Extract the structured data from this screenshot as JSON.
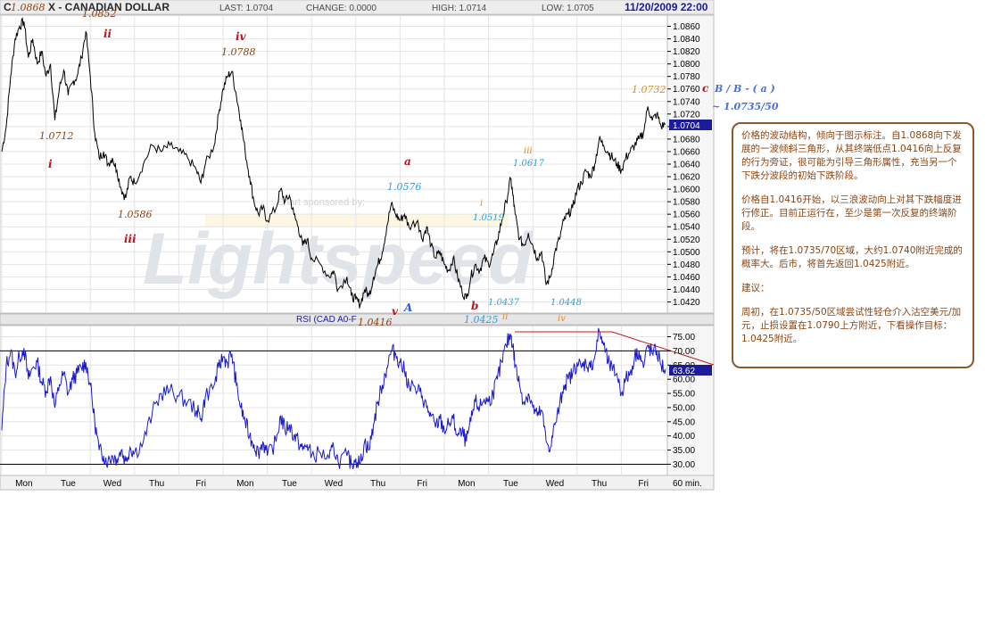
{
  "header": {
    "symbol": "C",
    "title": "X - CANADIAN DOLLAR",
    "last": "LAST: 1.0704",
    "change": "CHANGE: 0.0000",
    "high": "HIGH: 1.0714",
    "low": "LOW: 1.0705",
    "datetime": "11/20/2009 22:00"
  },
  "chart_data": [
    {
      "type": "line",
      "name": "price",
      "ylim": [
        1.0405,
        1.0875
      ],
      "yticks": [
        "1.0860",
        "1.0840",
        "1.0820",
        "1.0800",
        "1.0780",
        "1.0760",
        "1.0740",
        "1.0720",
        "1.0700",
        "1.0680",
        "1.0660",
        "1.0640",
        "1.0620",
        "1.0600",
        "1.0580",
        "1.0560",
        "1.0540",
        "1.0520",
        "1.0500",
        "1.0480",
        "1.0460",
        "1.0440",
        "1.0420"
      ],
      "last_value_label": "1.0704",
      "last_value": 1.0704,
      "x_days": [
        "Mon",
        "Tue",
        "Wed",
        "Thu",
        "Fri",
        "Mon",
        "Tue",
        "Wed",
        "Thu",
        "Fri",
        "Mon",
        "Tue",
        "Wed",
        "Thu",
        "Fri"
      ],
      "x_interval_label": "60 min.",
      "x_range": [
        0,
        15
      ],
      "path": [
        [
          0.0,
          1.066
        ],
        [
          0.1,
          1.07
        ],
        [
          0.2,
          1.078
        ],
        [
          0.3,
          1.084
        ],
        [
          0.4,
          1.086
        ],
        [
          0.5,
          1.0868
        ],
        [
          0.6,
          1.081
        ],
        [
          0.7,
          1.084
        ],
        [
          0.8,
          1.08
        ],
        [
          0.9,
          1.082
        ],
        [
          1.0,
          1.078
        ],
        [
          1.1,
          1.08
        ],
        [
          1.2,
          1.071
        ],
        [
          1.3,
          1.076
        ],
        [
          1.4,
          1.079
        ],
        [
          1.5,
          1.075
        ],
        [
          1.6,
          1.077
        ],
        [
          1.7,
          1.078
        ],
        [
          1.8,
          1.081
        ],
        [
          1.9,
          1.0852
        ],
        [
          2.0,
          1.078
        ],
        [
          2.1,
          1.069
        ],
        [
          2.2,
          1.065
        ],
        [
          2.3,
          1.066
        ],
        [
          2.4,
          1.064
        ],
        [
          2.5,
          1.065
        ],
        [
          2.6,
          1.063
        ],
        [
          2.7,
          1.06
        ],
        [
          2.8,
          1.0586
        ],
        [
          2.9,
          1.062
        ],
        [
          3.0,
          1.061
        ],
        [
          3.2,
          1.064
        ],
        [
          3.4,
          1.067
        ],
        [
          3.6,
          1.066
        ],
        [
          3.8,
          1.067
        ],
        [
          4.0,
          1.066
        ],
        [
          4.2,
          1.065
        ],
        [
          4.4,
          1.063
        ],
        [
          4.5,
          1.061
        ],
        [
          4.6,
          1.064
        ],
        [
          4.8,
          1.067
        ],
        [
          4.9,
          1.072
        ],
        [
          5.0,
          1.076
        ],
        [
          5.1,
          1.078
        ],
        [
          5.2,
          1.0788
        ],
        [
          5.3,
          1.075
        ],
        [
          5.4,
          1.071
        ],
        [
          5.5,
          1.066
        ],
        [
          5.6,
          1.062
        ],
        [
          5.7,
          1.058
        ],
        [
          5.8,
          1.056
        ],
        [
          5.9,
          1.057
        ],
        [
          6.0,
          1.055
        ],
        [
          6.2,
          1.057
        ],
        [
          6.3,
          1.06
        ],
        [
          6.4,
          1.058
        ],
        [
          6.5,
          1.059
        ],
        [
          6.6,
          1.056
        ],
        [
          6.7,
          1.054
        ],
        [
          6.8,
          1.051
        ],
        [
          6.9,
          1.052
        ],
        [
          7.0,
          1.049
        ],
        [
          7.2,
          1.048
        ],
        [
          7.4,
          1.046
        ],
        [
          7.5,
          1.047
        ],
        [
          7.6,
          1.044
        ],
        [
          7.8,
          1.046
        ],
        [
          7.9,
          1.043
        ],
        [
          8.0,
          1.0424
        ],
        [
          8.1,
          1.0416
        ],
        [
          8.2,
          1.044
        ],
        [
          8.3,
          1.043
        ],
        [
          8.4,
          1.046
        ],
        [
          8.5,
          1.048
        ],
        [
          8.6,
          1.05
        ],
        [
          8.7,
          1.054
        ],
        [
          8.8,
          1.0576
        ],
        [
          8.9,
          1.056
        ],
        [
          9.0,
          1.055
        ],
        [
          9.1,
          1.056
        ],
        [
          9.2,
          1.054
        ],
        [
          9.4,
          1.055
        ],
        [
          9.5,
          1.052
        ],
        [
          9.6,
          1.054
        ],
        [
          9.7,
          1.051
        ],
        [
          9.8,
          1.049
        ],
        [
          9.9,
          1.05
        ],
        [
          10.0,
          1.048
        ],
        [
          10.1,
          1.047
        ],
        [
          10.2,
          1.049
        ],
        [
          10.3,
          1.046
        ],
        [
          10.4,
          1.0437
        ],
        [
          10.5,
          1.0425
        ],
        [
          10.6,
          1.046
        ],
        [
          10.7,
          1.048
        ],
        [
          10.8,
          1.047
        ],
        [
          10.9,
          1.049
        ],
        [
          11.0,
          1.048
        ],
        [
          11.1,
          1.0495
        ],
        [
          11.2,
          1.0519
        ],
        [
          11.3,
          1.055
        ],
        [
          11.4,
          1.058
        ],
        [
          11.5,
          1.0617
        ],
        [
          11.55,
          1.059
        ],
        [
          11.6,
          1.056
        ],
        [
          11.7,
          1.052
        ],
        [
          11.8,
          1.051
        ],
        [
          11.9,
          1.053
        ],
        [
          12.0,
          1.051
        ],
        [
          12.1,
          1.049
        ],
        [
          12.2,
          1.05
        ],
        [
          12.3,
          1.0448
        ],
        [
          12.4,
          1.046
        ],
        [
          12.5,
          1.05
        ],
        [
          12.6,
          1.052
        ],
        [
          12.7,
          1.055
        ],
        [
          12.8,
          1.056
        ],
        [
          12.9,
          1.057
        ],
        [
          13.0,
          1.06
        ],
        [
          13.1,
          1.061
        ],
        [
          13.2,
          1.063
        ],
        [
          13.3,
          1.062
        ],
        [
          13.4,
          1.064
        ],
        [
          13.5,
          1.068
        ],
        [
          13.6,
          1.067
        ],
        [
          13.7,
          1.066
        ],
        [
          13.8,
          1.065
        ],
        [
          13.9,
          1.064
        ],
        [
          14.0,
          1.063
        ],
        [
          14.1,
          1.065
        ],
        [
          14.2,
          1.066
        ],
        [
          14.3,
          1.067
        ],
        [
          14.4,
          1.068
        ],
        [
          14.5,
          1.069
        ],
        [
          14.6,
          1.0732
        ],
        [
          14.7,
          1.071
        ],
        [
          14.8,
          1.072
        ],
        [
          14.9,
          1.07
        ],
        [
          15.0,
          1.0704
        ]
      ]
    },
    {
      "type": "line",
      "name": "rsi",
      "title": "RSI (CAD A0-F",
      "ylim": [
        27,
        78
      ],
      "yticks": [
        "75.00",
        "70.00",
        "65.00",
        "60.00",
        "55.00",
        "50.00",
        "45.00",
        "40.00",
        "35.00",
        "30.00"
      ],
      "last_value_label": "63.62",
      "last_value": 63.62,
      "levels": [
        70,
        30
      ],
      "path": [
        [
          0.0,
          42
        ],
        [
          0.1,
          65
        ],
        [
          0.2,
          70
        ],
        [
          0.3,
          62
        ],
        [
          0.4,
          68
        ],
        [
          0.5,
          71
        ],
        [
          0.6,
          60
        ],
        [
          0.7,
          64
        ],
        [
          0.8,
          66
        ],
        [
          0.9,
          59
        ],
        [
          1.0,
          56
        ],
        [
          1.1,
          61
        ],
        [
          1.2,
          50
        ],
        [
          1.3,
          58
        ],
        [
          1.4,
          62
        ],
        [
          1.5,
          55
        ],
        [
          1.6,
          60
        ],
        [
          1.7,
          62
        ],
        [
          1.8,
          64
        ],
        [
          1.9,
          66
        ],
        [
          2.0,
          58
        ],
        [
          2.1,
          45
        ],
        [
          2.2,
          35
        ],
        [
          2.3,
          33
        ],
        [
          2.4,
          31
        ],
        [
          2.5,
          33
        ],
        [
          2.6,
          32
        ],
        [
          2.7,
          35
        ],
        [
          2.8,
          31
        ],
        [
          2.9,
          36
        ],
        [
          3.0,
          34
        ],
        [
          3.2,
          38
        ],
        [
          3.4,
          48
        ],
        [
          3.6,
          55
        ],
        [
          3.8,
          56
        ],
        [
          4.0,
          54
        ],
        [
          4.2,
          52
        ],
        [
          4.4,
          49
        ],
        [
          4.5,
          46
        ],
        [
          4.6,
          54
        ],
        [
          4.8,
          58
        ],
        [
          4.9,
          64
        ],
        [
          5.0,
          68
        ],
        [
          5.1,
          66
        ],
        [
          5.2,
          69
        ],
        [
          5.3,
          58
        ],
        [
          5.4,
          50
        ],
        [
          5.5,
          45
        ],
        [
          5.6,
          40
        ],
        [
          5.7,
          37
        ],
        [
          5.8,
          34
        ],
        [
          5.9,
          38
        ],
        [
          6.0,
          33
        ],
        [
          6.2,
          38
        ],
        [
          6.3,
          47
        ],
        [
          6.4,
          42
        ],
        [
          6.5,
          44
        ],
        [
          6.6,
          40
        ],
        [
          6.7,
          38
        ],
        [
          6.8,
          35
        ],
        [
          6.9,
          37
        ],
        [
          7.0,
          33
        ],
        [
          7.2,
          34
        ],
        [
          7.4,
          32
        ],
        [
          7.5,
          36
        ],
        [
          7.6,
          31
        ],
        [
          7.8,
          33
        ],
        [
          7.9,
          30
        ],
        [
          8.0,
          32
        ],
        [
          8.1,
          30
        ],
        [
          8.2,
          38
        ],
        [
          8.3,
          35
        ],
        [
          8.4,
          44
        ],
        [
          8.5,
          52
        ],
        [
          8.6,
          58
        ],
        [
          8.7,
          64
        ],
        [
          8.8,
          70
        ],
        [
          8.9,
          69
        ],
        [
          9.0,
          66
        ],
        [
          9.1,
          63
        ],
        [
          9.2,
          58
        ],
        [
          9.4,
          56
        ],
        [
          9.5,
          54
        ],
        [
          9.6,
          50
        ],
        [
          9.7,
          47
        ],
        [
          9.8,
          43
        ],
        [
          9.9,
          46
        ],
        [
          10.0,
          42
        ],
        [
          10.1,
          44
        ],
        [
          10.2,
          46
        ],
        [
          10.3,
          40
        ],
        [
          10.4,
          41
        ],
        [
          10.5,
          38
        ],
        [
          10.6,
          45
        ],
        [
          10.7,
          52
        ],
        [
          10.8,
          50
        ],
        [
          10.9,
          53
        ],
        [
          11.0,
          52
        ],
        [
          11.1,
          55
        ],
        [
          11.2,
          60
        ],
        [
          11.3,
          66
        ],
        [
          11.4,
          72
        ],
        [
          11.5,
          76
        ],
        [
          11.55,
          72
        ],
        [
          11.6,
          65
        ],
        [
          11.7,
          58
        ],
        [
          11.8,
          52
        ],
        [
          11.9,
          55
        ],
        [
          12.0,
          50
        ],
        [
          12.1,
          47
        ],
        [
          12.2,
          49
        ],
        [
          12.3,
          38
        ],
        [
          12.4,
          36
        ],
        [
          12.5,
          44
        ],
        [
          12.6,
          50
        ],
        [
          12.7,
          58
        ],
        [
          12.8,
          60
        ],
        [
          12.9,
          62
        ],
        [
          13.0,
          66
        ],
        [
          13.1,
          64
        ],
        [
          13.2,
          66
        ],
        [
          13.3,
          64
        ],
        [
          13.4,
          68
        ],
        [
          13.5,
          77
        ],
        [
          13.6,
          72
        ],
        [
          13.7,
          66
        ],
        [
          13.8,
          63
        ],
        [
          13.9,
          62
        ],
        [
          14.0,
          55
        ],
        [
          14.1,
          60
        ],
        [
          14.2,
          62
        ],
        [
          14.3,
          68
        ],
        [
          14.4,
          70
        ],
        [
          14.5,
          64
        ],
        [
          14.6,
          72
        ],
        [
          14.7,
          69
        ],
        [
          14.8,
          70
        ],
        [
          14.9,
          65
        ],
        [
          15.0,
          63.6
        ]
      ]
    }
  ],
  "annotations": {
    "price_labels": {
      "p1_0868": "1.0868",
      "p1_0852": "1.0852",
      "p1_0712": "1.0712",
      "p1_0788": "1.0788",
      "p1_0586": "1.0586",
      "p1_0576": "1.0576",
      "p1_0519": "1.0519",
      "p1_0617": "1.0617",
      "p1_0437": "1.0437",
      "p1_0448": "1.0448",
      "p1_0425": "1.0425",
      "p1_0416": "1.0416",
      "p1_0732": "1.0732"
    },
    "wave_labels": {
      "i": "i",
      "ii": "ii",
      "iii": "iii",
      "iv": "iv",
      "v": "v",
      "A": "A",
      "a": "a",
      "b": "b",
      "c": "c",
      "i_small": "i",
      "ii_small": "ii",
      "iii_small": "iii",
      "iv_small": "iv"
    },
    "wave_target": "B / B - ( a )",
    "target_zone": "~ 1.0735/50",
    "watermark_sponsor": "Chart sponsored by:",
    "watermark_brand": "Lightspeed"
  },
  "colors": {
    "price_line": "#000000",
    "rsi_line": "#1a1acc",
    "label_blue": "#2aa0e0",
    "label_orange": "#e08a20",
    "label_brown": "#8b4513",
    "label_red": "#c0101a",
    "trend_red": "#c41a1a",
    "last_value_bg": "#1c1c9a",
    "grid": "#e4e4e4",
    "axis_panel": "#f4f4f4"
  },
  "comment": {
    "p1": "价格的波动结构，倾向于图示标注。自1.0868向下发展的一波倾斜三角形，从其终端低点1.0416向上反复的行为旁证，很可能为引导三角形属性，充当另一个下跌分波段的初始下跌阶段。",
    "p2": "价格自1.0416开始，以三浪波动向上对其下跌幅度进行修正。目前正运行在，至少是第一次反复的终端阶段。",
    "p3": "预计，将在1.0735/70区域，大约1.0740附近完成的概率大。后市，将首先返回1.0425附近。",
    "p4": "建议：",
    "p5": "周初，在1.0735/50区域尝试性轻仓介入沽空美元/加元，止损设置在1.0790上方附近，下看操作目标：1.0425附近。"
  }
}
